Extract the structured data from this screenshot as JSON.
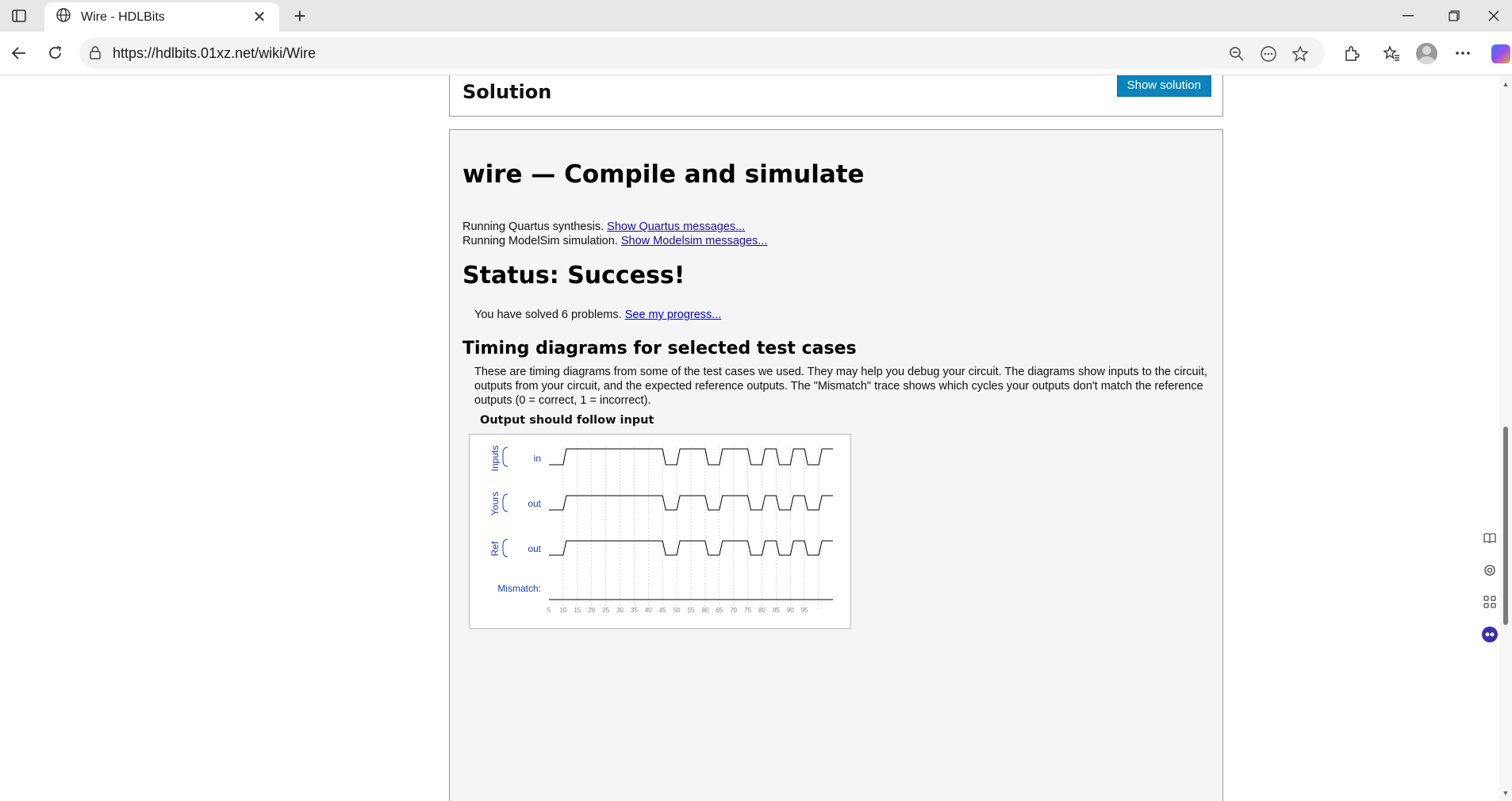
{
  "browser": {
    "tab_title": "Wire - HDLBits",
    "url": "https://hdlbits.01xz.net/wiki/Wire",
    "new_tab": "+",
    "close_tab": "✕"
  },
  "solution": {
    "title": "Solution",
    "button_label": "Show solution"
  },
  "result": {
    "heading": "wire — Compile and simulate",
    "quartus_text": "Running Quartus synthesis.",
    "quartus_link": "Show Quartus messages...",
    "modelsim_text": "Running ModelSim simulation.",
    "modelsim_link": "Show Modelsim messages...",
    "status_heading": "Status: Success!",
    "solved_text": "You have solved 6 problems.",
    "progress_link": "See my progress...",
    "timing_heading": "Timing diagrams for selected test cases",
    "timing_description": "These are timing diagrams from some of the test cases we used. They may help you debug your circuit. The diagrams show inputs to the circuit, outputs from your circuit, and the expected reference outputs. The \"Mismatch\" trace shows which cycles your outputs don't match the reference outputs (0 = correct, 1 = incorrect).",
    "diagram_title": "Output should follow input"
  },
  "timing_diagram": {
    "groups": [
      "Inputs",
      "Yours",
      "Ref"
    ],
    "signals": [
      "in",
      "out",
      "out"
    ],
    "mismatch_label": "Mismatch:",
    "time_ticks": [
      "5",
      "10",
      "15",
      "20",
      "25",
      "30",
      "35",
      "40",
      "45",
      "50",
      "55",
      "60",
      "65",
      "70",
      "75",
      "80",
      "85",
      "90",
      "95"
    ],
    "waveform": [
      0,
      1,
      1,
      1,
      1,
      1,
      1,
      1,
      0,
      1,
      1,
      0,
      1,
      1,
      0,
      1,
      0,
      1,
      0,
      1
    ],
    "mismatch": [
      0,
      0,
      0,
      0,
      0,
      0,
      0,
      0,
      0,
      0,
      0,
      0,
      0,
      0,
      0,
      0,
      0,
      0,
      0,
      0
    ],
    "label_color": "#1a3fb5"
  },
  "colors": {
    "button": "#0b84be",
    "link": "#1a0dab",
    "panel_bg": "#f5f5f5"
  }
}
